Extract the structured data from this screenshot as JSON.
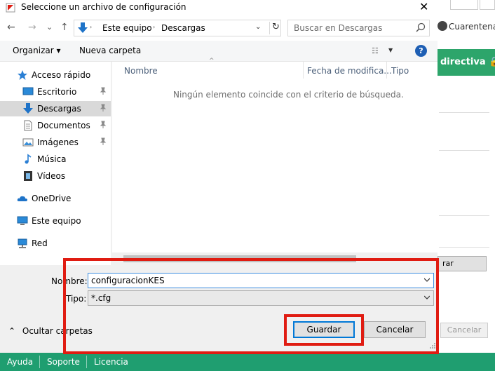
{
  "dialog": {
    "title": "Seleccione un archivo de configuración",
    "close_glyph": "✕"
  },
  "nav": {
    "back_glyph": "←",
    "forward_glyph": "→",
    "recent_glyph": "⌄",
    "up_glyph": "↑",
    "breadcrumbs": [
      "Este equipo",
      "Descargas"
    ],
    "refresh_glyph": "↻",
    "search_placeholder": "Buscar en Descargas"
  },
  "toolbar": {
    "organize_label": "Organizar ▾",
    "new_folder_label": "Nueva carpeta",
    "help_glyph": "?"
  },
  "sidebar": {
    "items": [
      {
        "label": "Acceso rápido",
        "icon": "star-icon"
      },
      {
        "label": "Escritorio",
        "icon": "desktop-icon"
      },
      {
        "label": "Descargas",
        "icon": "download-icon"
      },
      {
        "label": "Documentos",
        "icon": "document-icon"
      },
      {
        "label": "Imágenes",
        "icon": "image-icon"
      },
      {
        "label": "Música",
        "icon": "music-icon"
      },
      {
        "label": "Vídeos",
        "icon": "video-icon"
      },
      {
        "label": "OneDrive",
        "icon": "cloud-icon"
      },
      {
        "label": "Este equipo",
        "icon": "computer-icon"
      },
      {
        "label": "Red",
        "icon": "network-icon"
      }
    ],
    "selected": "Descargas"
  },
  "file_list": {
    "columns": [
      "Nombre",
      "Fecha de modifica...",
      "Tipo"
    ],
    "empty_message": "Ningún elemento coincide con el criterio de búsqueda."
  },
  "form": {
    "name_label": "Nombre:",
    "name_value": "configuracionKES",
    "type_label": "Tipo:",
    "type_value": "*.cfg",
    "hide_folders_label": "Ocultar carpetas",
    "save_label": "Guardar",
    "cancel_label": "Cancelar"
  },
  "background_app": {
    "quarantine_label": "Cuarentena",
    "policy_label": "directiva",
    "partial_button_label": "rar",
    "cancel_label": "Cancelar"
  },
  "footer": {
    "links": [
      "Ayuda",
      "Soporte",
      "Licencia"
    ]
  },
  "colors": {
    "highlight": "#e01c12",
    "footer_green": "#1f9e70",
    "policy_green": "#2da56b",
    "accent_blue": "#0078d7"
  }
}
